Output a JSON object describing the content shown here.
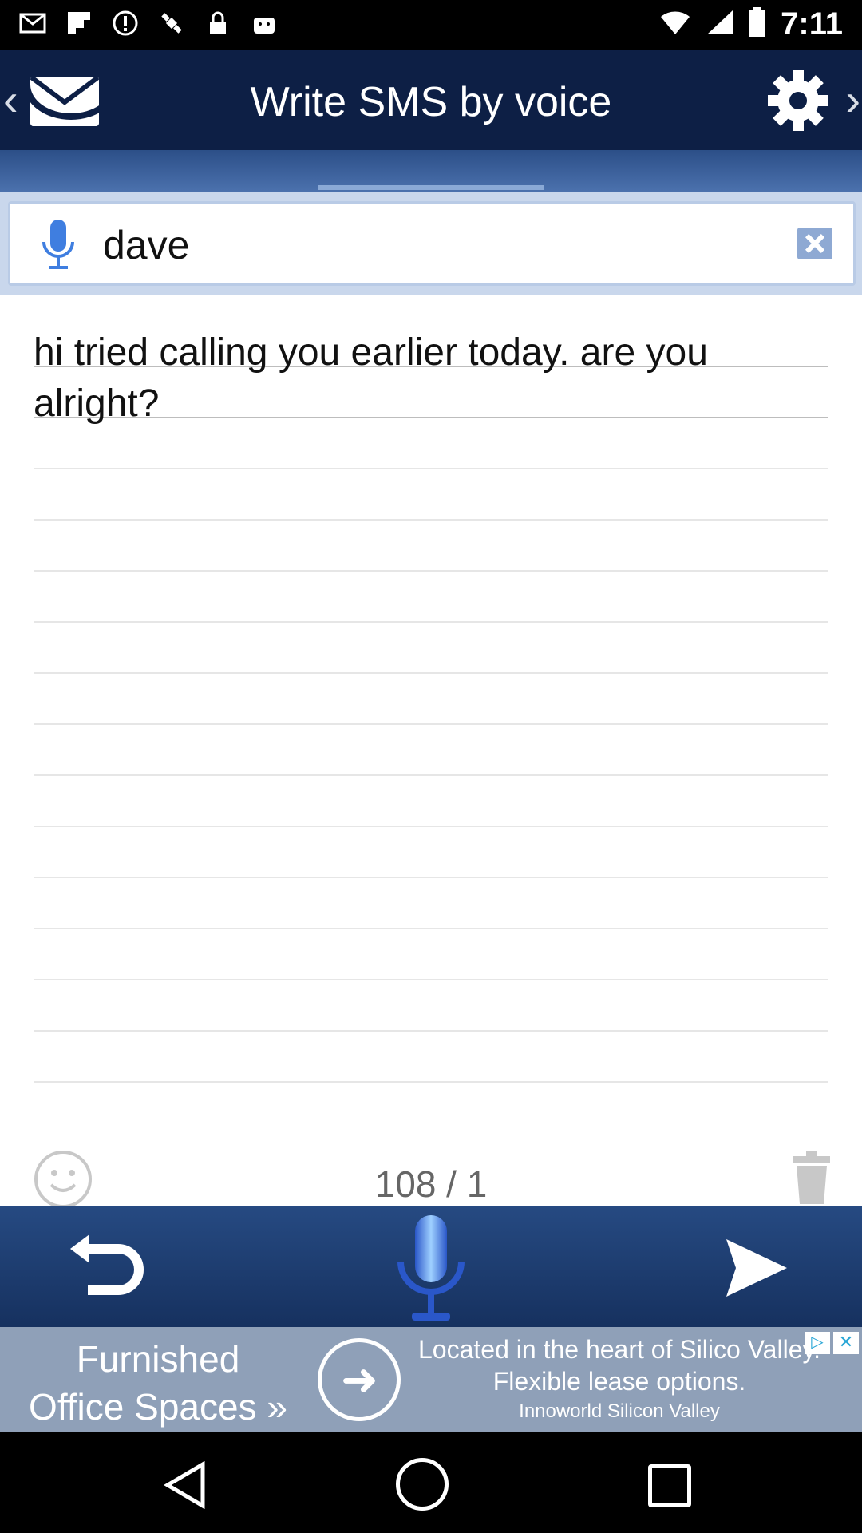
{
  "status_bar": {
    "time": "7:11"
  },
  "header": {
    "title": "Write SMS by voice"
  },
  "recipient": {
    "value": "dave"
  },
  "message": {
    "text": "hi tried calling you earlier today. are you alright?"
  },
  "counter": {
    "text": "108 / 1"
  },
  "ad": {
    "left_line1": "Furnished",
    "left_line2": "Office Spaces »",
    "right_text": "Located in the heart of Silico Valley. Flexible lease options.",
    "sponsor": "Innoworld Silicon Valley",
    "info_glyph": "▷",
    "close_glyph": "✕"
  },
  "colors": {
    "header_bg": "#0d1f45",
    "toolbar_bg": "#1e3d72",
    "accent_blue": "#3f7ee0"
  }
}
